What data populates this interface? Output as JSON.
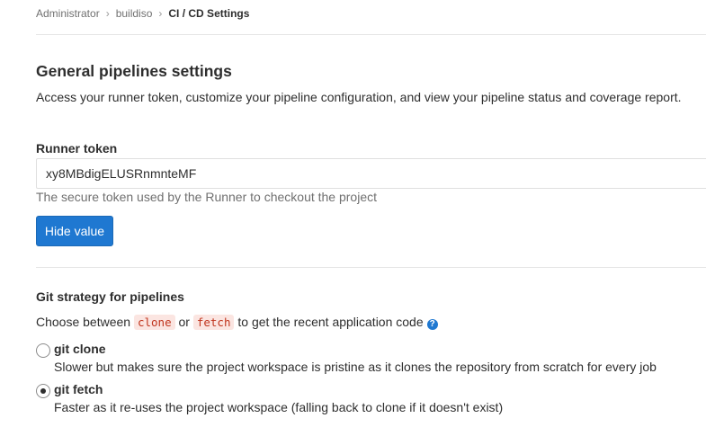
{
  "breadcrumb": {
    "items": [
      "Administrator",
      "buildiso",
      "CI / CD Settings"
    ]
  },
  "section": {
    "title": "General pipelines settings",
    "description": "Access your runner token, customize your pipeline configuration, and view your pipeline status and coverage report."
  },
  "runner_token": {
    "label": "Runner token",
    "value": "xy8MBdigELUSRnmnteMF",
    "help": "The secure token used by the Runner to checkout the project",
    "hide_button": "Hide value"
  },
  "git_strategy": {
    "label": "Git strategy for pipelines",
    "choose_prefix": "Choose between",
    "code_clone": "clone",
    "or_text": "or",
    "code_fetch": "fetch",
    "choose_suffix": "to get the recent application code",
    "help_icon": "question-circle-icon",
    "options": [
      {
        "title": "git clone",
        "description": "Slower but makes sure the project workspace is pristine as it clones the repository from scratch for every job",
        "checked": false
      },
      {
        "title": "git fetch",
        "description": "Faster as it re-uses the project workspace (falling back to clone if it doesn't exist)",
        "checked": true
      }
    ]
  },
  "colors": {
    "primary": "#1f78d1",
    "code_text": "#c0341d",
    "code_bg": "#fbe5e1"
  }
}
